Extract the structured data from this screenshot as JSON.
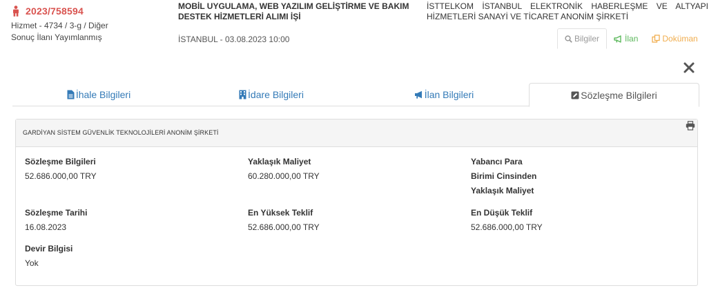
{
  "header": {
    "ikn": "2023/758594",
    "meta_line1": "Hizmet - 4734 / 3-g / Diğer",
    "meta_line2": "Sonuç İlanı Yayımlanmış",
    "title": "MOBİL UYGULAMA, WEB YAZILIM GELİŞTİRME VE BAKIM DESTEK HİZMETLERİ ALIMI İŞİ",
    "location_date": "İSTANBUL - 03.08.2023 10:00",
    "authority": "İSTTELKOM İSTANBUL ELEKTRONİK HABERLEŞME VE ALTYAPI HİZMETLERİ SANAYİ VE TİCARET ANONİM ŞİRKETİ"
  },
  "actions": {
    "bilgiler": "Bilgiler",
    "ilan": "İlan",
    "dokuman": "Doküman"
  },
  "tabs": {
    "ihale": "İhale Bilgileri",
    "idare": "İdare Bilgileri",
    "ilan": "İlan Bilgileri",
    "sozlesme": "Sözleşme Bilgileri"
  },
  "panel": {
    "company": "GARDİYAN SİSTEM GÜVENLİK TEKNOLOJİLERİ ANONİM ŞİRKETİ",
    "fields": {
      "sozlesme_bilgileri": {
        "label": "Sözleşme Bilgileri",
        "value": "52.686.000,00 TRY"
      },
      "yaklasik_maliyet": {
        "label": "Yaklaşık Maliyet",
        "value": "60.280.000,00 TRY"
      },
      "yabanci_para": {
        "label_line1": "Yabancı Para",
        "label_line2": "Birimi Cinsinden",
        "label_line3": "Yaklaşık Maliyet"
      },
      "sozlesme_tarihi": {
        "label": "Sözleşme Tarihi",
        "value": "16.08.2023"
      },
      "en_yuksek_teklif": {
        "label": "En Yüksek Teklif",
        "value": "52.686.000,00 TRY"
      },
      "en_dusuk_teklif": {
        "label": "En Düşük Teklif",
        "value": "52.686.000,00 TRY"
      },
      "devir_bilgisi": {
        "label": "Devir Bilgisi",
        "value": "Yok"
      }
    }
  },
  "colors": {
    "accent_red": "#d9534f",
    "link_blue": "#337ab7",
    "success_green": "#5cb85c",
    "warning_orange": "#f0ad4e"
  },
  "icons": {
    "ikn": "person-icon",
    "bilgiler": "search-icon",
    "ilan": "megaphone-icon",
    "dokuman": "copy-icon",
    "close": "close-icon",
    "tab_ihale": "file-text-icon",
    "tab_idare": "building-icon",
    "tab_ilan": "megaphone-icon",
    "tab_sozlesme": "edit-icon",
    "print": "print-icon"
  }
}
